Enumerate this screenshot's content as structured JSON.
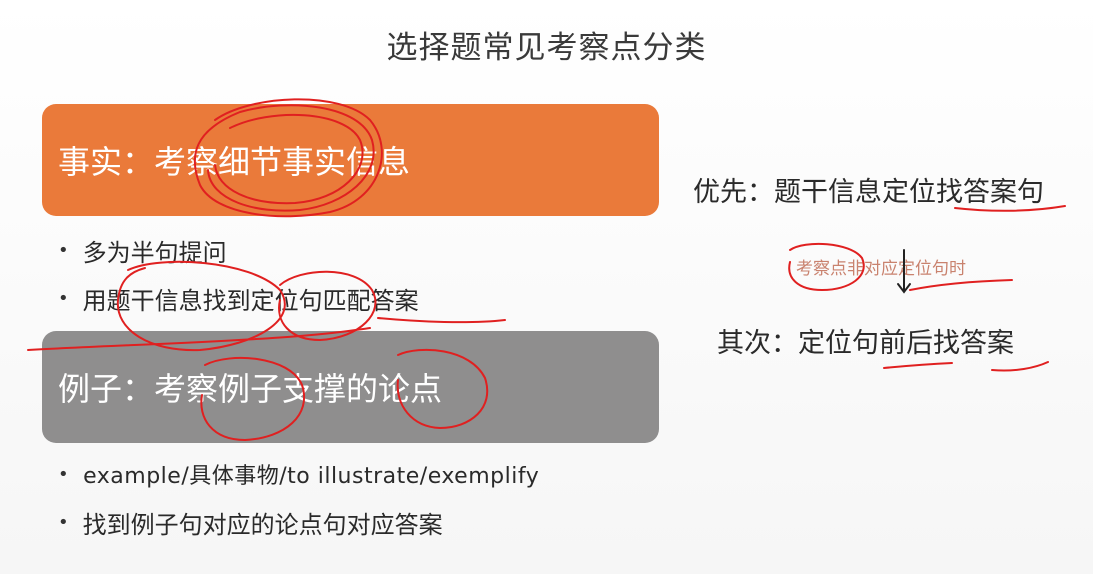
{
  "title": "选择题常见考察点分类",
  "fact": {
    "heading": "事实：考察细节事实信息",
    "bullets": [
      "多为半句提问",
      "用题干信息找到定位句匹配答案"
    ]
  },
  "example": {
    "heading": "例子：考察例子支撑的论点",
    "bullets": [
      "example/具体事物/to illustrate/exemplify",
      "找到例子句对应的论点句对应答案"
    ]
  },
  "strategy": {
    "first": "优先：题干信息定位找答案句",
    "note": "考察点非对应定位句时",
    "second": "其次：定位句前后找答案"
  },
  "colors": {
    "orange_banner": "#ea7a3a",
    "gray_banner": "#8f8e8e",
    "ink": "#e02020"
  },
  "bullet_glyph": "•"
}
